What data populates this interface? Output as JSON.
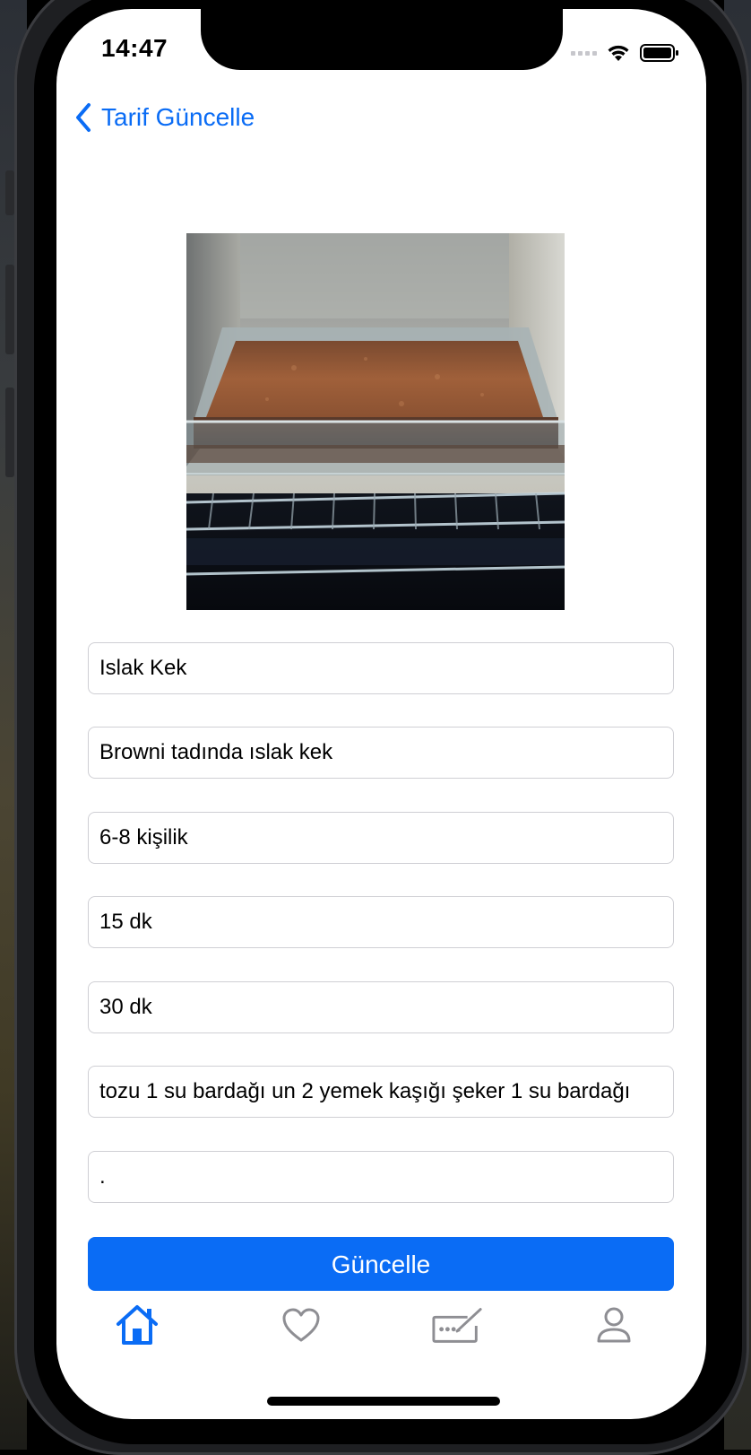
{
  "status_bar": {
    "time": "14:47"
  },
  "nav": {
    "back_label": "Tarif Güncelle",
    "icon": "chevron-left-icon",
    "accent_color": "#0A6CF5"
  },
  "recipe_image": {
    "description_icon": "recipe-photo"
  },
  "form": {
    "fields": [
      {
        "value": "Islak Kek"
      },
      {
        "value": "Browni tadında ıslak kek"
      },
      {
        "value": "6-8 kişilik"
      },
      {
        "value": "15 dk"
      },
      {
        "value": "30 dk"
      },
      {
        "value": "tozu 1 su bardağı un 2 yemek kaşığı şeker 1 su bardağı"
      },
      {
        "value": "."
      }
    ],
    "submit_label": "Güncelle"
  },
  "tab_bar": {
    "items": [
      {
        "icon": "home-icon",
        "active": true
      },
      {
        "icon": "heart-icon",
        "active": false
      },
      {
        "icon": "edit-keyboard-icon",
        "active": false
      },
      {
        "icon": "person-icon",
        "active": false
      }
    ],
    "active_color": "#0A6CF5",
    "inactive_color": "#8E8E93"
  }
}
